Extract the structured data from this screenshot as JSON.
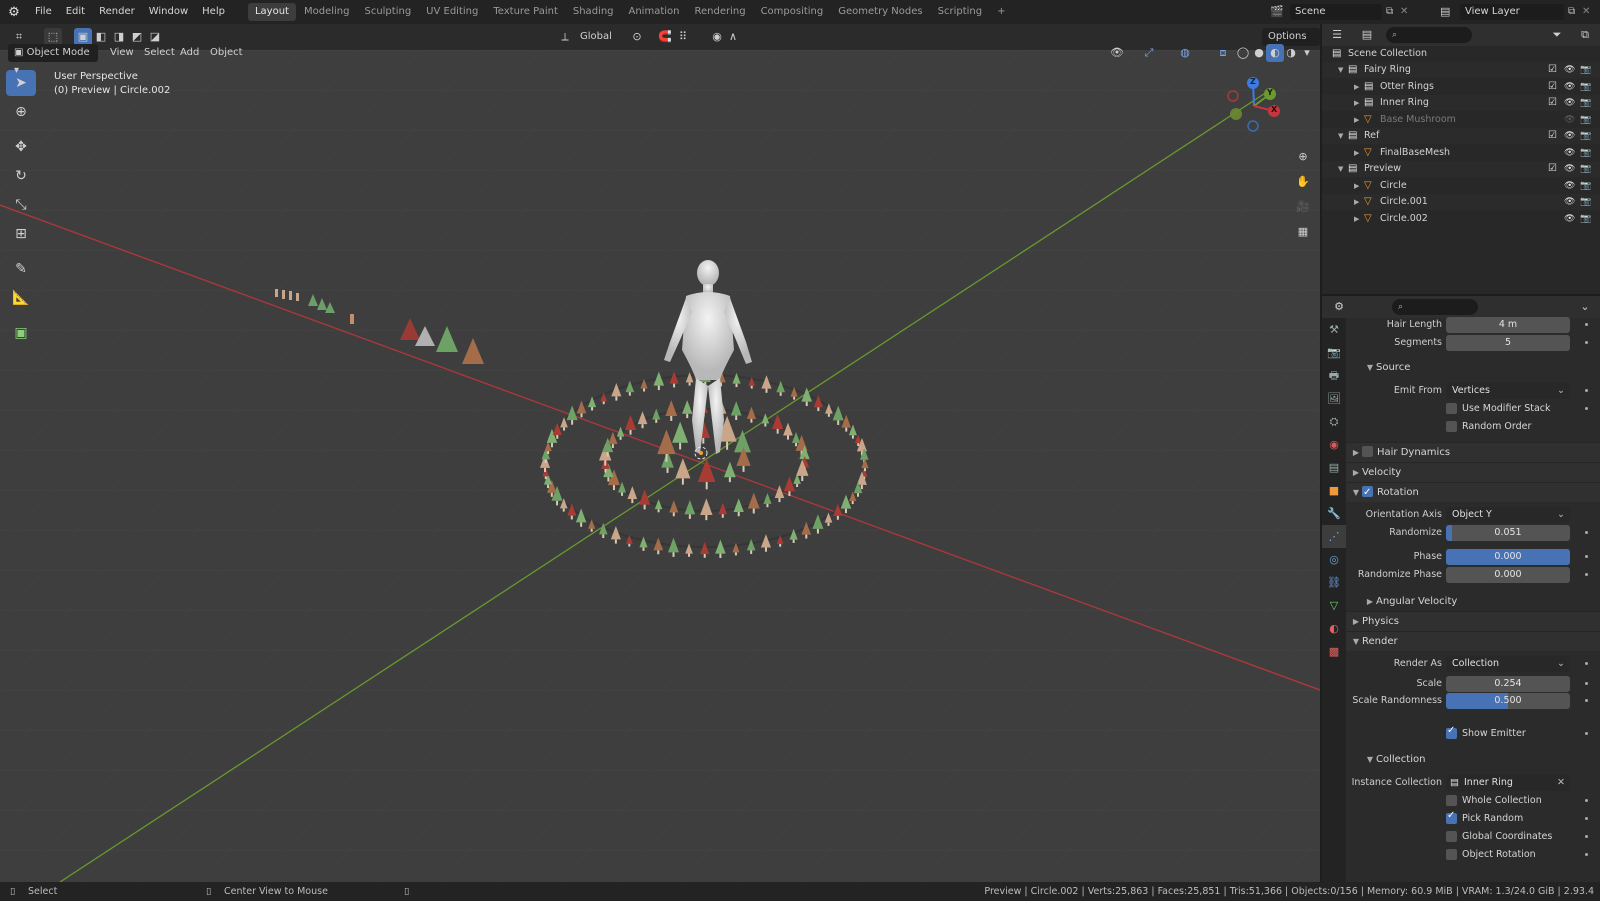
{
  "menu": [
    "File",
    "Edit",
    "Render",
    "Window",
    "Help"
  ],
  "workspaces": [
    "Layout",
    "Modeling",
    "Sculpting",
    "UV Editing",
    "Texture Paint",
    "Shading",
    "Animation",
    "Rendering",
    "Compositing",
    "Geometry Nodes",
    "Scripting"
  ],
  "active_workspace": "Layout",
  "add_workspace": "+",
  "scene_name": "Scene",
  "view_layer": "View Layer",
  "header": {
    "mode": "Object Mode",
    "menus": [
      "View",
      "Select",
      "Add",
      "Object"
    ],
    "transform_orientation": "Global",
    "options": "Options"
  },
  "viewport": {
    "perspective": "User Perspective",
    "info": "(0) Preview | Circle.002",
    "gizmo": {
      "z": "Z",
      "y": "Y",
      "x": "X"
    }
  },
  "outliner": {
    "rows": [
      {
        "label": "Scene Collection",
        "indent": 0,
        "type": "collection",
        "dim": false
      },
      {
        "label": "Fairy Ring",
        "indent": 1,
        "type": "collection",
        "dim": false
      },
      {
        "label": "Otter Rings",
        "indent": 2,
        "type": "collection",
        "dim": false
      },
      {
        "label": "Inner Ring",
        "indent": 2,
        "type": "collection",
        "dim": false
      },
      {
        "label": "Base Mushroom",
        "indent": 2,
        "type": "object",
        "dim": true
      },
      {
        "label": "Ref",
        "indent": 1,
        "type": "collection",
        "dim": false
      },
      {
        "label": "FinalBaseMesh",
        "indent": 2,
        "type": "object",
        "dim": false
      },
      {
        "label": "Preview",
        "indent": 1,
        "type": "collection",
        "dim": false
      },
      {
        "label": "Circle",
        "indent": 2,
        "type": "object",
        "dim": false
      },
      {
        "label": "Circle.001",
        "indent": 2,
        "type": "object",
        "dim": false
      },
      {
        "label": "Circle.002",
        "indent": 2,
        "type": "object",
        "dim": false
      }
    ]
  },
  "properties": {
    "hair_length": {
      "label": "Hair Length",
      "value": "4 m"
    },
    "segments": {
      "label": "Segments",
      "value": "5"
    },
    "source": "Source",
    "emit_from": {
      "label": "Emit From",
      "value": "Vertices"
    },
    "use_modifier_stack": "Use Modifier Stack",
    "random_order": "Random Order",
    "hair_dynamics": "Hair Dynamics",
    "velocity": "Velocity",
    "rotation": "Rotation",
    "orientation_axis": {
      "label": "Orientation Axis",
      "value": "Object Y"
    },
    "randomize": {
      "label": "Randomize",
      "value": "0.051",
      "fraction": 0.051
    },
    "phase": {
      "label": "Phase",
      "value": "0.000",
      "fraction": 1.0
    },
    "randomize_phase": {
      "label": "Randomize Phase",
      "value": "0.000",
      "fraction": 0
    },
    "angular_velocity": "Angular Velocity",
    "physics": "Physics",
    "render": "Render",
    "render_as": {
      "label": "Render As",
      "value": "Collection"
    },
    "scale": {
      "label": "Scale",
      "value": "0.254",
      "fraction": 0
    },
    "scale_randomness": {
      "label": "Scale Randomness",
      "value": "0.500",
      "fraction": 0.5
    },
    "show_emitter": "Show Emitter",
    "collection": "Collection",
    "instance_collection": {
      "label": "Instance Collection",
      "value": "Inner Ring"
    },
    "whole_collection": "Whole Collection",
    "pick_random": "Pick Random",
    "global_coordinates": "Global Coordinates",
    "object_rotation": "Object Rotation"
  },
  "status": {
    "left1": "Select",
    "left2": "Center View to Mouse",
    "right": "Preview | Circle.002 | Verts:25,863 | Faces:25,851 | Tris:51,366 | Objects:0/156 | Memory: 60.9 MiB | VRAM: 1.3/24.0 GiB | 2.93.4"
  },
  "colors": {
    "accent": "#4772b3",
    "x_axis": "#c7353f",
    "y_axis": "#6c9a2f",
    "z_axis": "#3c7ce0"
  }
}
